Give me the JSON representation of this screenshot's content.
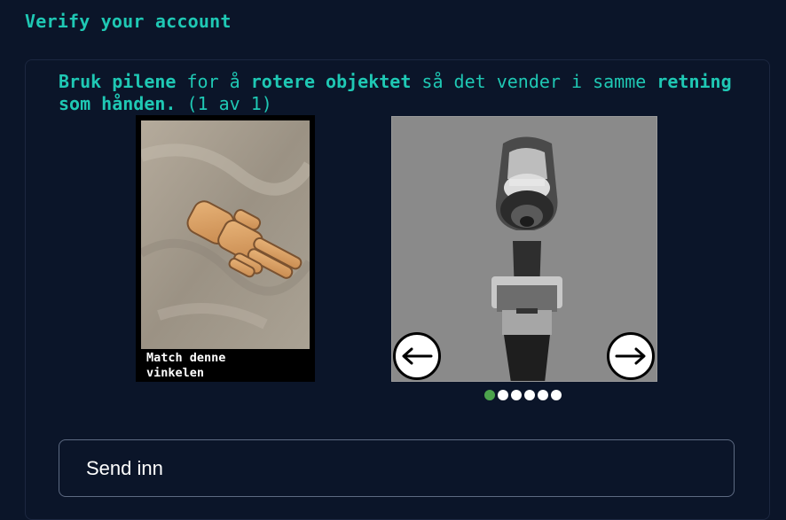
{
  "page": {
    "title": "Verify your account"
  },
  "instructions": {
    "part1_bold": "Bruk pilene",
    "part2": " for å ",
    "part3_bold": "rotere objektet",
    "part4": " så det vender i samme ",
    "part5_bold": "retning som hånden.",
    "part6": " (1 av 1)"
  },
  "reference": {
    "caption": "Match denne\nvinkelen",
    "image_icon": "wooden-hand-pointing"
  },
  "rotator": {
    "image_icon": "power-drill",
    "left_arrow": "←",
    "right_arrow": "→",
    "dots": [
      {
        "active": true
      },
      {
        "active": false
      },
      {
        "active": false
      },
      {
        "active": false
      },
      {
        "active": false
      },
      {
        "active": false
      }
    ]
  },
  "submit": {
    "label": "Send inn"
  },
  "colors": {
    "background": "#0b1529",
    "accent": "#1fc8b4",
    "dot_active": "#4ca34c"
  }
}
